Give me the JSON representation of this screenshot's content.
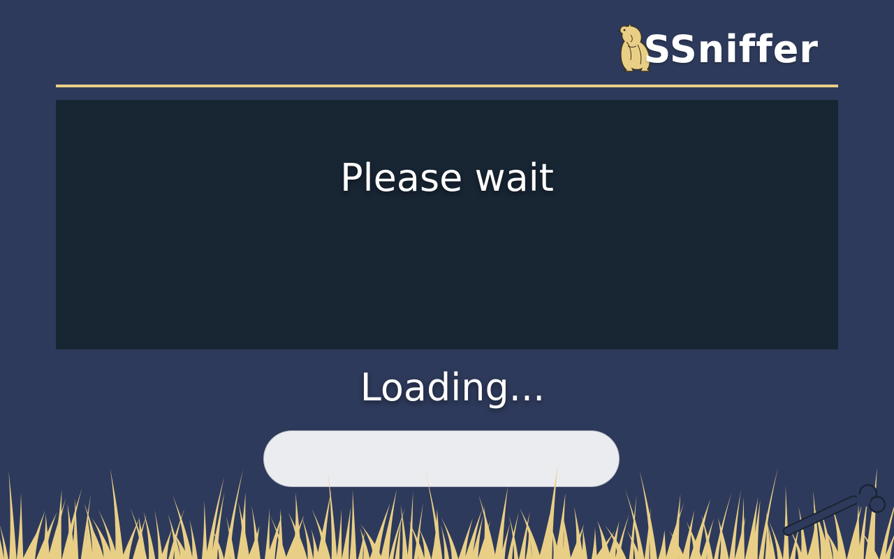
{
  "brand": {
    "name": "SSniffer",
    "logo_icon": "prairie-dog-icon",
    "accent_color": "#e9cf86"
  },
  "panel": {
    "title": "Please wait"
  },
  "loading": {
    "label": "Loading...",
    "progress_fraction": 0
  },
  "decor": {
    "grass_icon": "grass-decoration",
    "bone_icon": "bone-icon",
    "background_color": "#2e3a5b",
    "panel_color": "#182533"
  }
}
